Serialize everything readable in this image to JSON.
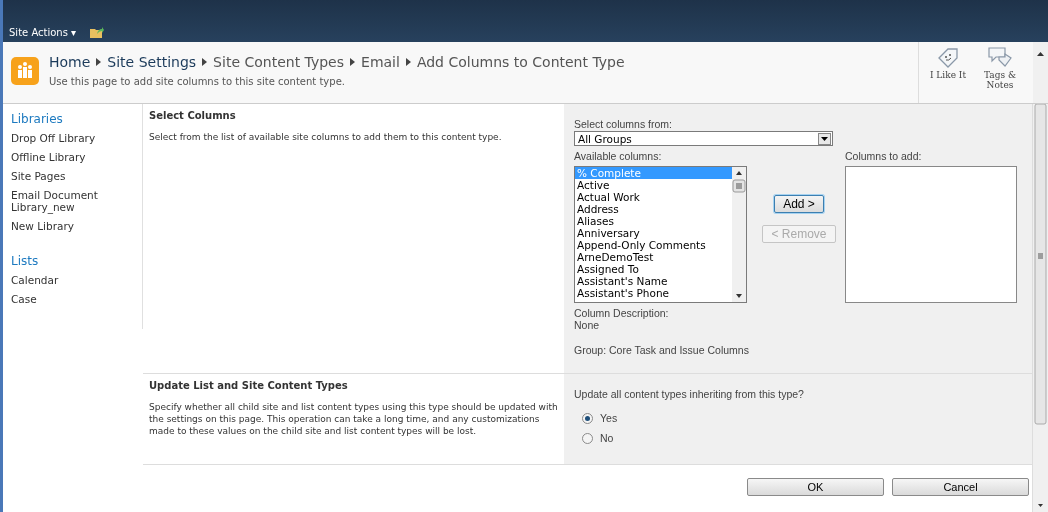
{
  "top_bar": {
    "site_actions": "Site Actions ▾"
  },
  "breadcrumb": [
    {
      "label": "Home",
      "kind": "link"
    },
    {
      "label": "Site Settings",
      "kind": "link"
    },
    {
      "label": "Site Content Types",
      "kind": "text"
    },
    {
      "label": "Email",
      "kind": "text"
    },
    {
      "label": "Add Columns to Content Type",
      "kind": "text"
    }
  ],
  "page_description": "Use this page to add site columns to this site content type.",
  "social": [
    {
      "label": "I Like It",
      "kind": "like"
    },
    {
      "label": "Tags & Notes",
      "kind": "tags"
    }
  ],
  "sidebar": [
    {
      "heading": "Libraries",
      "items": [
        "Drop Off Library",
        "Offline Library",
        "Site Pages",
        "Email Document Library_new",
        "New Library"
      ]
    },
    {
      "heading": "Lists",
      "items": [
        "Calendar",
        "Case"
      ]
    }
  ],
  "select_columns": {
    "title": "Select Columns",
    "description": "Select from the list of available site columns to add them to this content type.",
    "source_label": "Select columns from:",
    "source_value": "All Groups",
    "available_label": "Available columns:",
    "available": [
      {
        "label": "% Complete",
        "selected": true
      },
      {
        "label": "Active",
        "selected": false
      },
      {
        "label": "Actual Work",
        "selected": false
      },
      {
        "label": "Address",
        "selected": false
      },
      {
        "label": "Aliases",
        "selected": false
      },
      {
        "label": "Anniversary",
        "selected": false
      },
      {
        "label": "Append-Only Comments",
        "selected": false
      },
      {
        "label": "ArneDemoTest",
        "selected": false
      },
      {
        "label": "Assigned To",
        "selected": false
      },
      {
        "label": "Assistant's Name",
        "selected": false
      },
      {
        "label": "Assistant's Phone",
        "selected": false
      }
    ],
    "add_button": {
      "label": "Add >",
      "disabled": false
    },
    "remove_button": {
      "label": "< Remove",
      "disabled": true
    },
    "to_add_label": "Columns to add:",
    "description_label": "Column Description:",
    "description_value": "None",
    "group": "Group: Core Task and Issue Columns"
  },
  "update_types": {
    "title": "Update List and Site Content Types",
    "description": "Specify whether all child site and list content types using this type should be updated with the settings on this page. This operation can take a long time, and any customizations made to these values on the child site and list content types will be lost.",
    "question": "Update all content types inheriting from this type?",
    "options": [
      {
        "label": "Yes",
        "selected": true
      },
      {
        "label": "No",
        "selected": false
      }
    ]
  },
  "buttons": [
    "OK",
    "Cancel"
  ]
}
